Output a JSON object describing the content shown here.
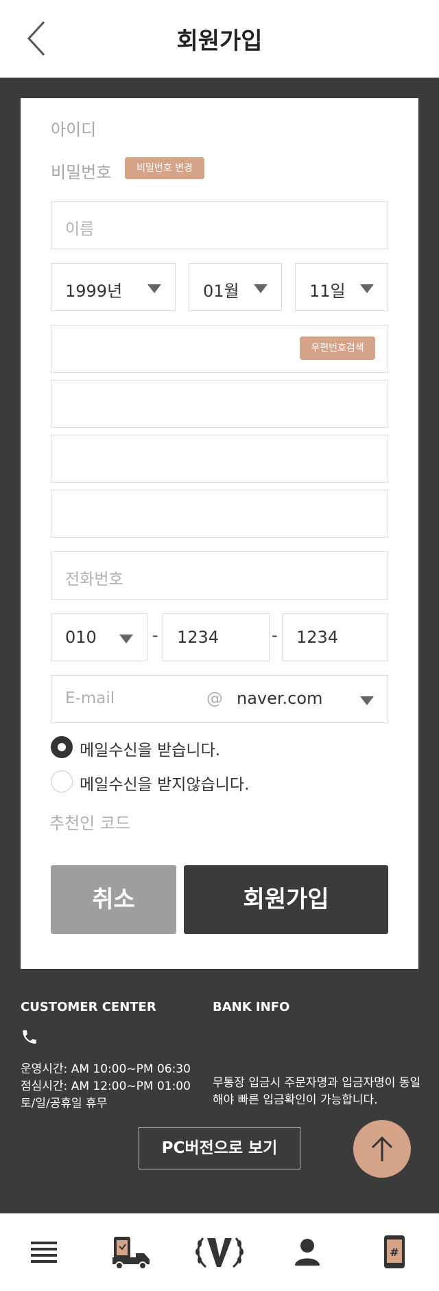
{
  "header": {
    "title": "회원가입"
  },
  "form": {
    "id_label": "아이디",
    "password_label": "비밀번호",
    "password_change_button": "비밀번호 변경",
    "name_placeholder": "이름",
    "birth_year": "1999년",
    "birth_month": "01월",
    "birth_day": "11일",
    "zip_button": "우편번호검색",
    "phone_placeholder": "전화번호",
    "mobile_prefix": "010",
    "mobile_dash": "-",
    "mobile_middle": "1234",
    "mobile_last": "1234",
    "email_placeholder": "E-mail",
    "email_at": "@",
    "email_domain": "naver.com",
    "mail_receive_yes": "메일수신을 받습니다.",
    "mail_receive_no": "메일수신을 받지않습니다.",
    "referrer_label": "추천인 코드",
    "cancel_button": "취소",
    "submit_button": "회원가입"
  },
  "footer": {
    "customer_center_title": "CUSTOMER CENTER",
    "hours_line1": "운영시간: AM 10:00~PM 06:30",
    "hours_line2": "점심시간: AM 12:00~PM 01:00",
    "hours_line3": "토/일/공휴일 휴무",
    "bank_info_title": "BANK INFO",
    "bank_note_line1": "무통장 입금시 주문자명과 입금자명이 동일",
    "bank_note_line2": "해야 빠른 입금확인이 가능합니다.",
    "pc_version_button": "PC버전으로 보기"
  },
  "colors": {
    "accent": "#d4a388",
    "dark": "#3b3b3b",
    "cancel_gray": "#9e9e9e"
  },
  "icons": {
    "back": "chevron-left-icon",
    "phone": "phone-icon",
    "scroll_top": "arrow-up-icon",
    "nav_menu": "menu-icon",
    "nav_delivery": "delivery-truck-icon",
    "nav_home": "laurel-v-logo-icon",
    "nav_mypage": "user-icon",
    "nav_mobile": "mobile-hash-icon"
  }
}
